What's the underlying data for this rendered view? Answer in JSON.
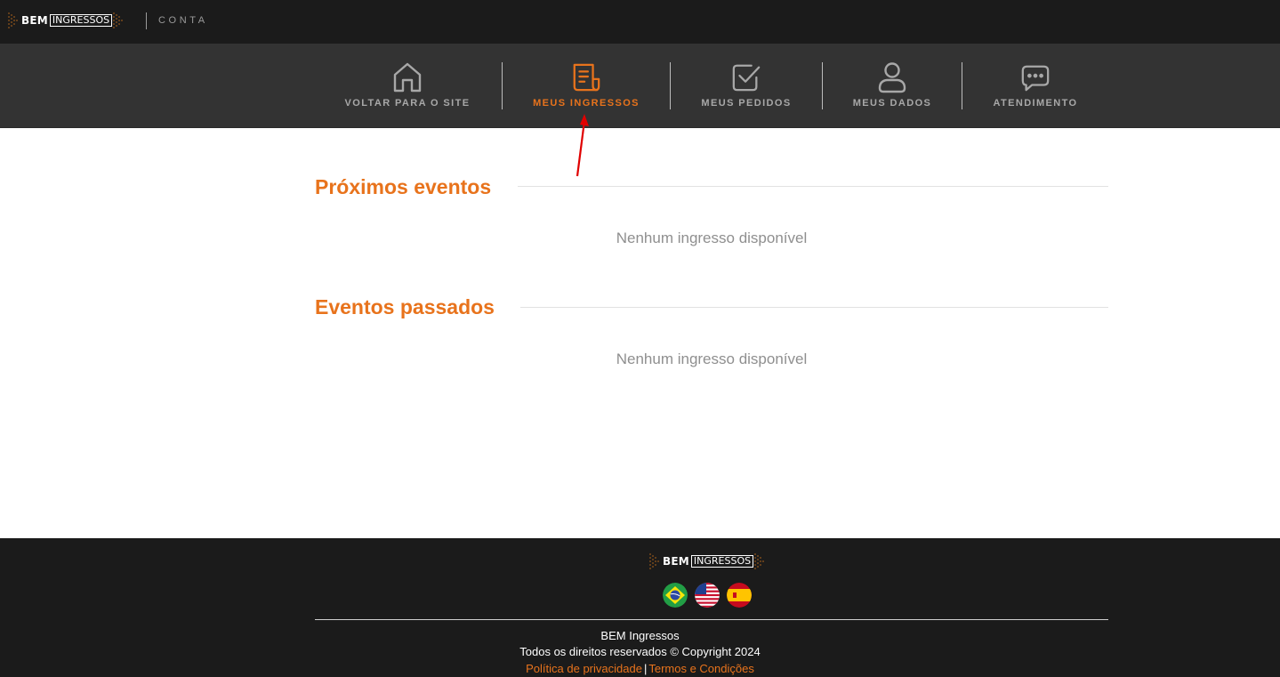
{
  "header": {
    "logo": {
      "part1": "BEM",
      "part2": "INGRESSOS"
    },
    "section_label": "CONTA"
  },
  "nav": {
    "items": [
      {
        "label": "VOLTAR PARA O SITE",
        "icon": "home-icon",
        "active": false
      },
      {
        "label": "MEUS INGRESSOS",
        "icon": "ticket-icon",
        "active": true
      },
      {
        "label": "MEUS PEDIDOS",
        "icon": "checkbox-icon",
        "active": false
      },
      {
        "label": "MEUS DADOS",
        "icon": "user-icon",
        "active": false
      },
      {
        "label": "ATENDIMENTO",
        "icon": "chat-icon",
        "active": false
      }
    ]
  },
  "main": {
    "upcoming": {
      "title": "Próximos eventos",
      "empty_text": "Nenhum ingresso disponível"
    },
    "past": {
      "title": "Eventos passados",
      "empty_text": "Nenhum ingresso disponível"
    }
  },
  "footer": {
    "logo": {
      "part1": "BEM",
      "part2": "INGRESSOS"
    },
    "languages": [
      "brazil-flag-icon",
      "usa-flag-icon",
      "spain-flag-icon"
    ],
    "company": "BEM Ingressos",
    "copyright": "Todos os direitos reservados © Copyright 2024",
    "privacy_link": "Política de privacidade",
    "separator": "|",
    "terms_link": "Termos e Condições"
  },
  "colors": {
    "accent": "#e8731c",
    "topbar_bg": "#1b1b1b",
    "navbar_bg": "#333333",
    "nav_inactive": "#a8a8a8",
    "annotation_arrow": "#e00000"
  }
}
